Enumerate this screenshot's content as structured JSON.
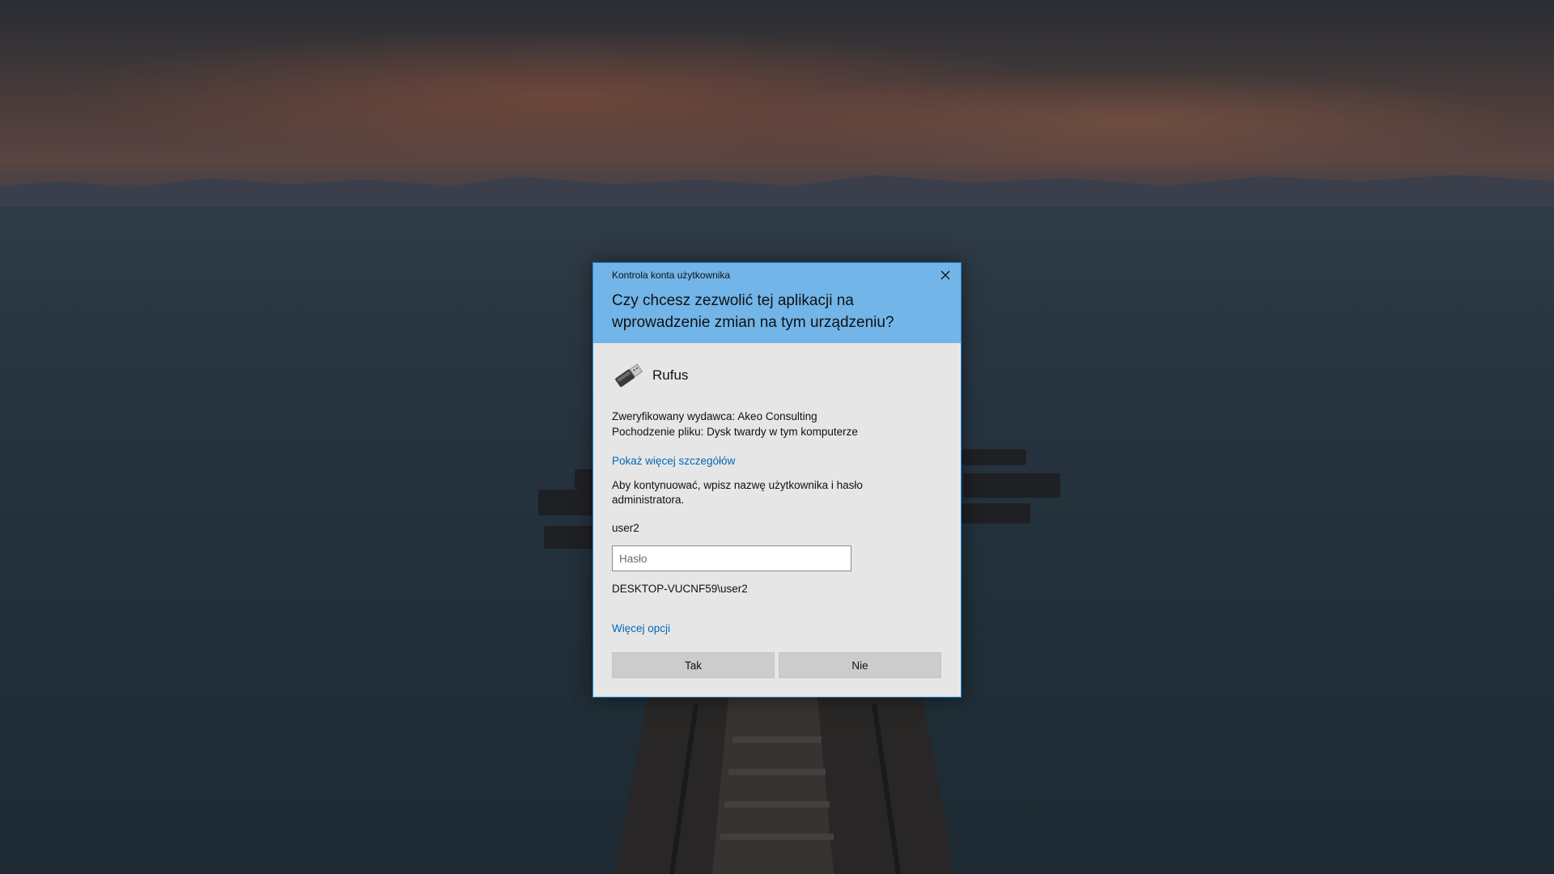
{
  "dialog": {
    "caption": "Kontrola konta użytkownika",
    "question": "Czy chcesz zezwolić tej aplikacji na wprowadzenie zmian na tym urządzeniu?",
    "app_name": "Rufus",
    "app_icon": "usb-drive-icon",
    "publisher_line": "Zweryfikowany wydawca: Akeo Consulting",
    "origin_line": "Pochodzenie pliku: Dysk twardy w tym komputerze",
    "details_link": "Pokaż więcej szczegółów",
    "instructions": "Aby kontynuować, wpisz nazwę użytkownika i hasło administratora.",
    "username": "user2",
    "password_placeholder": "Hasło",
    "password_value": "",
    "domain_user": "DESKTOP-VUCNF59\\user2",
    "more_options_link": "Więcej opcji",
    "yes_label": "Tak",
    "no_label": "Nie"
  },
  "colors": {
    "header": "#72b5e8",
    "body": "#e6e6e6",
    "link": "#0067b8",
    "button": "#cccccc"
  }
}
